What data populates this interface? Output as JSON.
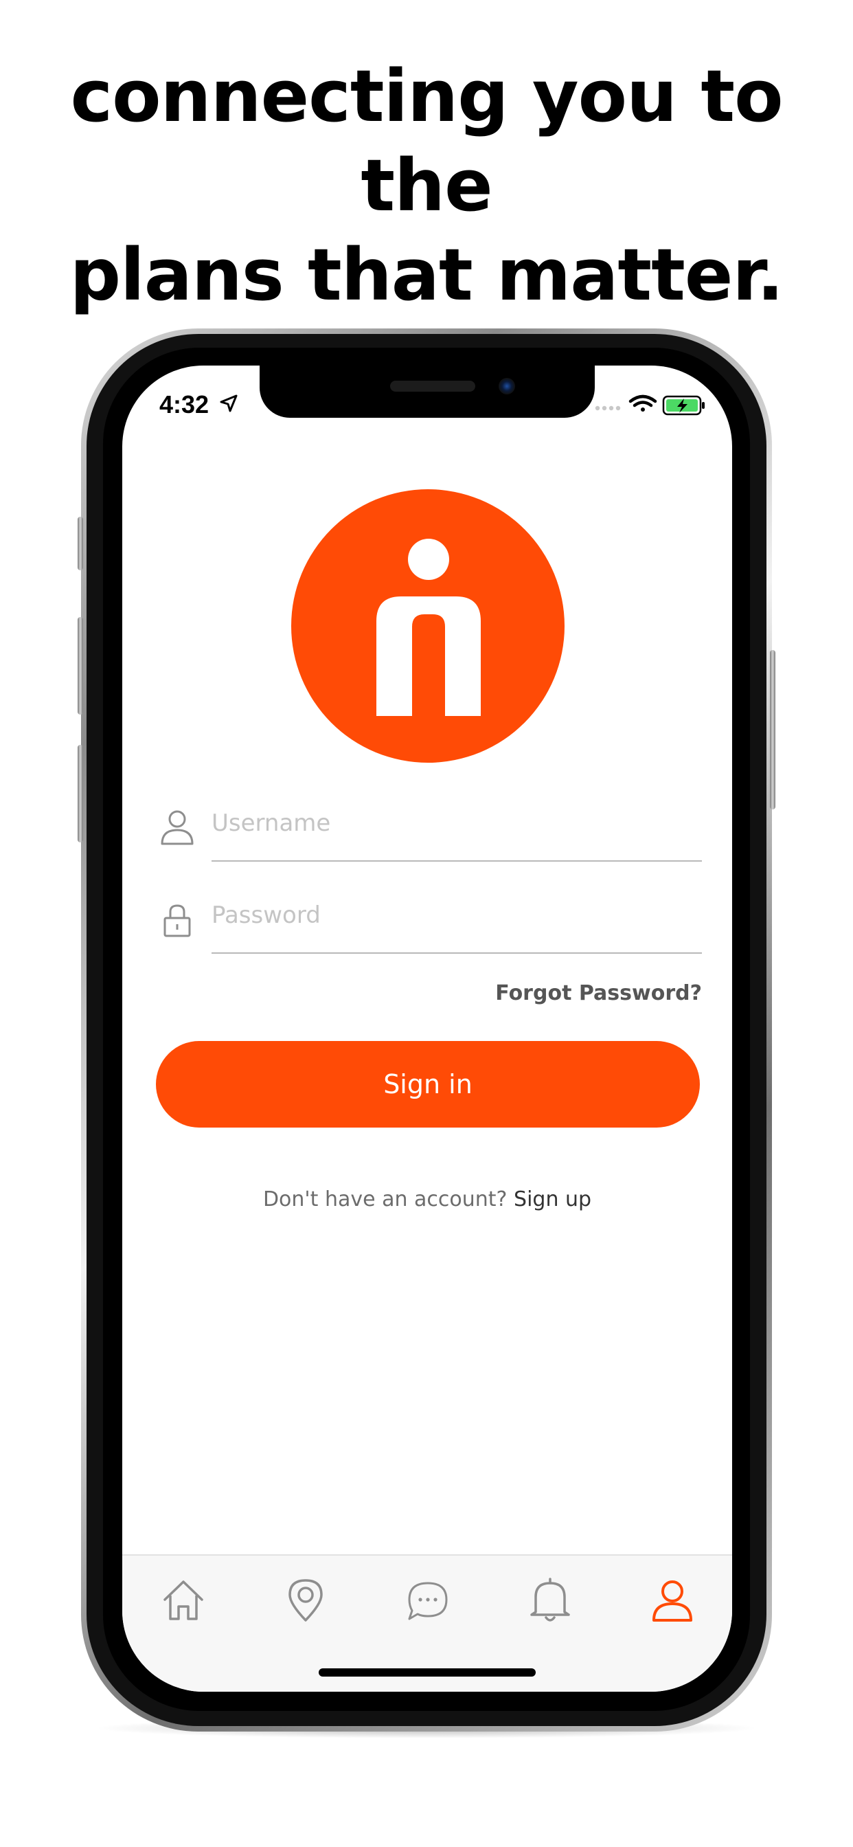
{
  "headline": {
    "line1": "connecting you to the",
    "line2": "plans that matter."
  },
  "status_bar": {
    "time": "4:32"
  },
  "login": {
    "username_placeholder": "Username",
    "password_placeholder": "Password",
    "forgot_label": "Forgot Password?",
    "signin_label": "Sign in",
    "no_account_text": "Don't have an account?",
    "signup_label": "Sign up"
  },
  "tabbar": {
    "items": [
      {
        "name": "home",
        "icon": "home-icon"
      },
      {
        "name": "map",
        "icon": "location-pin-icon"
      },
      {
        "name": "messages",
        "icon": "chat-bubble-icon"
      },
      {
        "name": "notifications",
        "icon": "bell-icon"
      },
      {
        "name": "profile",
        "icon": "person-icon",
        "active": true
      }
    ]
  },
  "colors": {
    "accent": "#ff4b06",
    "inactive_icon": "#8e8e8e",
    "placeholder": "#c4c4c4"
  }
}
